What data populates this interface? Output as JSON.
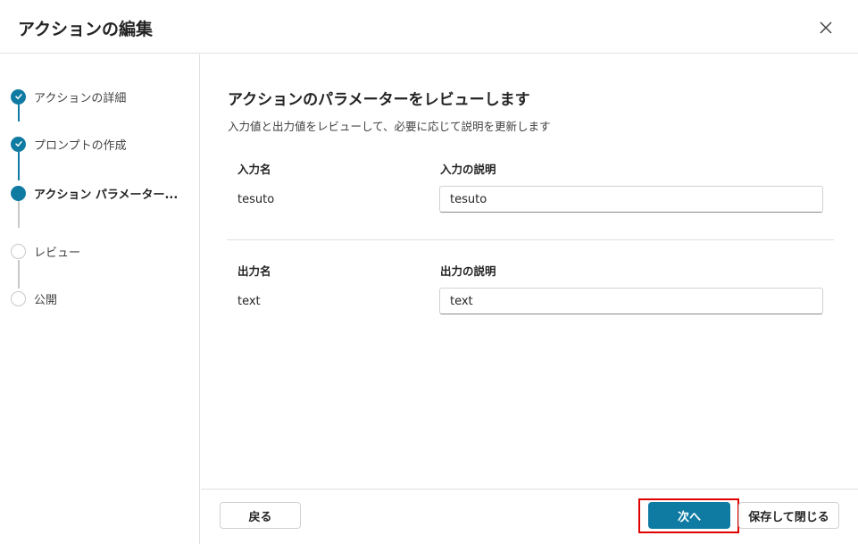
{
  "dialog": {
    "title": "アクションの編集",
    "close_icon": "close-icon"
  },
  "steps": [
    {
      "label": "アクションの詳細",
      "status": "completed"
    },
    {
      "label": "プロンプトの作成",
      "status": "completed"
    },
    {
      "label": "アクション パラメーター...",
      "status": "current"
    },
    {
      "label": "レビュー",
      "status": "pending"
    },
    {
      "label": "公開",
      "status": "pending"
    }
  ],
  "main": {
    "title": "アクションのパラメーターをレビューします",
    "subtitle": "入力値と出力値をレビューして、必要に応じて説明を更新します",
    "input_section": {
      "name_header": "入力名",
      "desc_header": "入力の説明",
      "name": "tesuto",
      "description": "tesuto"
    },
    "output_section": {
      "name_header": "出力名",
      "desc_header": "出力の説明",
      "name": "text",
      "description": "text"
    }
  },
  "footer": {
    "back_label": "戻る",
    "next_label": "次へ",
    "save_close_label": "保存して閉じる"
  },
  "colors": {
    "accent": "#0f7ba3",
    "highlight": "#e00000"
  }
}
